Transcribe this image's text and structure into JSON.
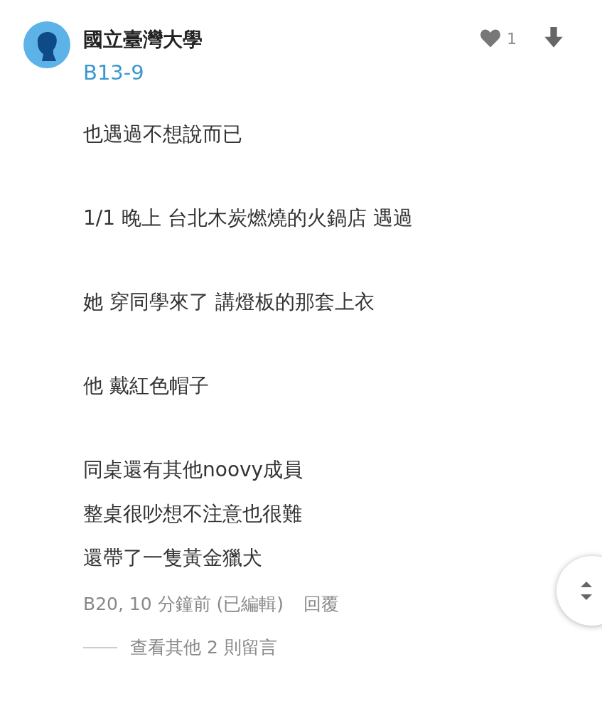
{
  "author": {
    "school": "國立臺灣大學",
    "tag": "B13-9"
  },
  "likes": {
    "count": "1"
  },
  "paragraphs": [
    [
      "也遇過不想說而已"
    ],
    [
      "1/1  晚上 台北木炭燃燒的火鍋店 遇過"
    ],
    [
      "她 穿同學來了 講燈板的那套上衣"
    ],
    [
      "他  戴紅色帽子"
    ],
    [
      "同桌還有其他noovy成員",
      "整桌很吵想不注意也很難",
      "還帶了一隻黃金獵犬"
    ]
  ],
  "meta": {
    "info": "B20, 10 分鐘前 (已編輯)",
    "reply": "回覆"
  },
  "more_replies": "查看其他 2 則留言"
}
